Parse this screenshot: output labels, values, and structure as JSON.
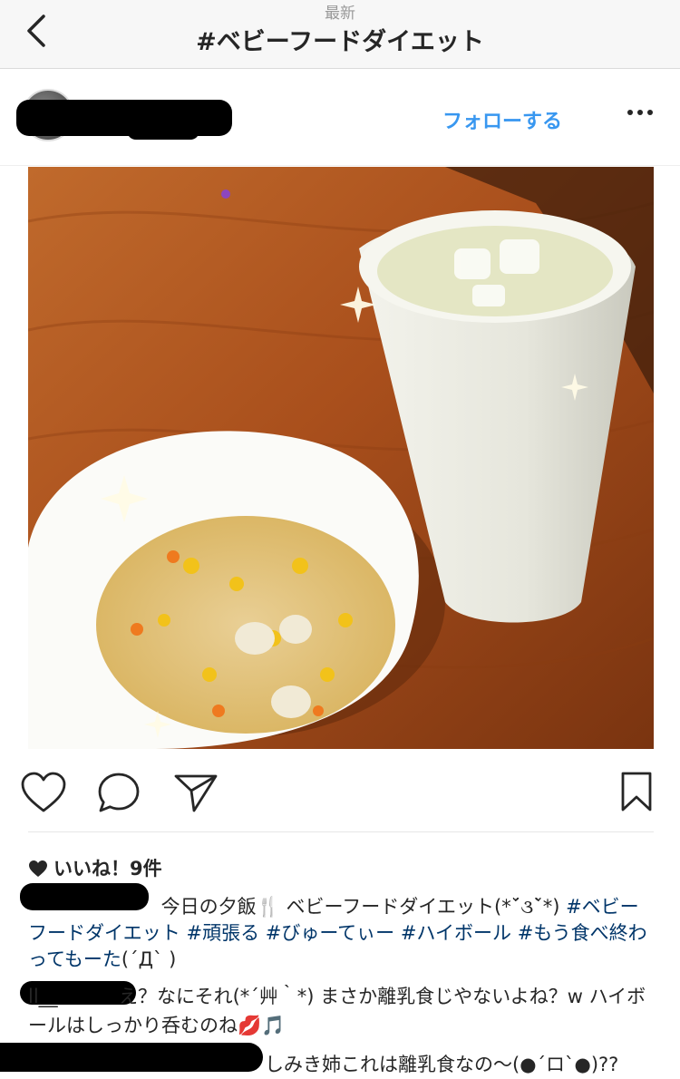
{
  "nav": {
    "subtitle": "最新",
    "title": "#ベビーフードダイエット"
  },
  "post": {
    "follow_label": "フォローする",
    "likes_label": "いいね！9件",
    "caption": {
      "text": " 今日の夕飯🍴 ベビーフードダイエット(*ˊ̆૩ˋ̆*) ",
      "hashtags": [
        "#ベビーフードダイエット",
        "#頑張る",
        "#びゅーてぃー",
        "#ハイボール",
        "#もう食べ終わってもーた"
      ],
      "tail": "(´Д` )"
    },
    "comments": [
      {
        "user_fragment": "ll__",
        "text": "え？なにそれ(*´艸｀*) まさか離乳食じやないよね？w ハイボールはしっかり呑むのね💋🎵"
      },
      {
        "user_fragment": "",
        "text": "しみき姉これは離乳食なの〜(●´ロ`●)??"
      }
    ]
  },
  "colors": {
    "accent": "#3897f0",
    "hashtag": "#003569",
    "nav_bg": "#f7f7f7"
  },
  "icons": [
    "back-chevron-icon",
    "more-dots-icon",
    "heart-icon",
    "comment-icon",
    "share-icon",
    "bookmark-icon",
    "like-heart-filled-icon"
  ]
}
